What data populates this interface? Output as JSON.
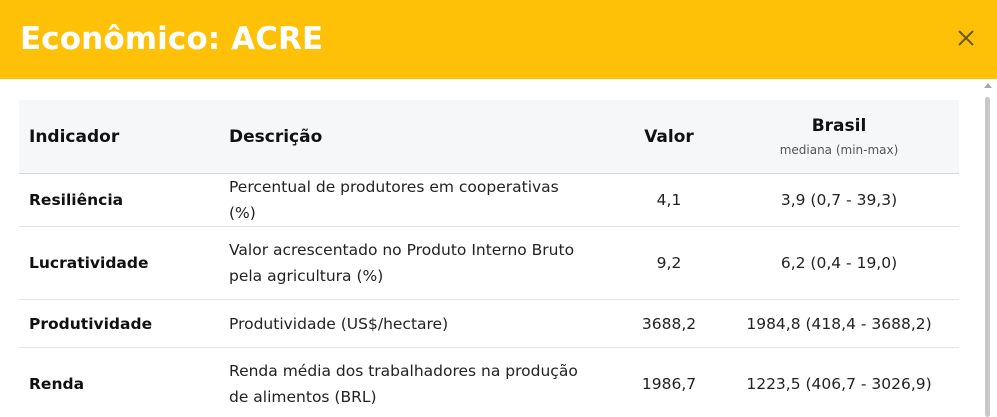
{
  "modal": {
    "title": "Econômico: ACRE",
    "close_icon": "close-icon"
  },
  "table": {
    "headers": {
      "indicator": "Indicador",
      "description": "Descrição",
      "value": "Valor",
      "brasil": "Brasil",
      "brasil_sub": "mediana (min-max)"
    },
    "rows": [
      {
        "indicator": "Resiliência",
        "description": "Percentual de produtores em cooperativas (%)",
        "value": "4,1",
        "brasil": "3,9 (0,7 - 39,3)"
      },
      {
        "indicator": "Lucratividade",
        "description": "Valor acrescentado no Produto Interno Bruto pela agricultura (%)",
        "value": "9,2",
        "brasil": "6,2 (0,4 - 19,0)"
      },
      {
        "indicator": "Produtividade",
        "description": "Produtividade (US$/hectare)",
        "value": "3688,2",
        "brasil": "1984,8 (418,4 - 3688,2)"
      },
      {
        "indicator": "Renda",
        "description": "Renda média dos trabalhadores na produção de alimentos (BRL)",
        "value": "1986,7",
        "brasil": "1223,5 (406,7 - 3026,9)"
      }
    ]
  },
  "colors": {
    "header_bg": "#fec107",
    "title_text": "#ffffff",
    "table_head_bg": "#f6f7f9"
  }
}
